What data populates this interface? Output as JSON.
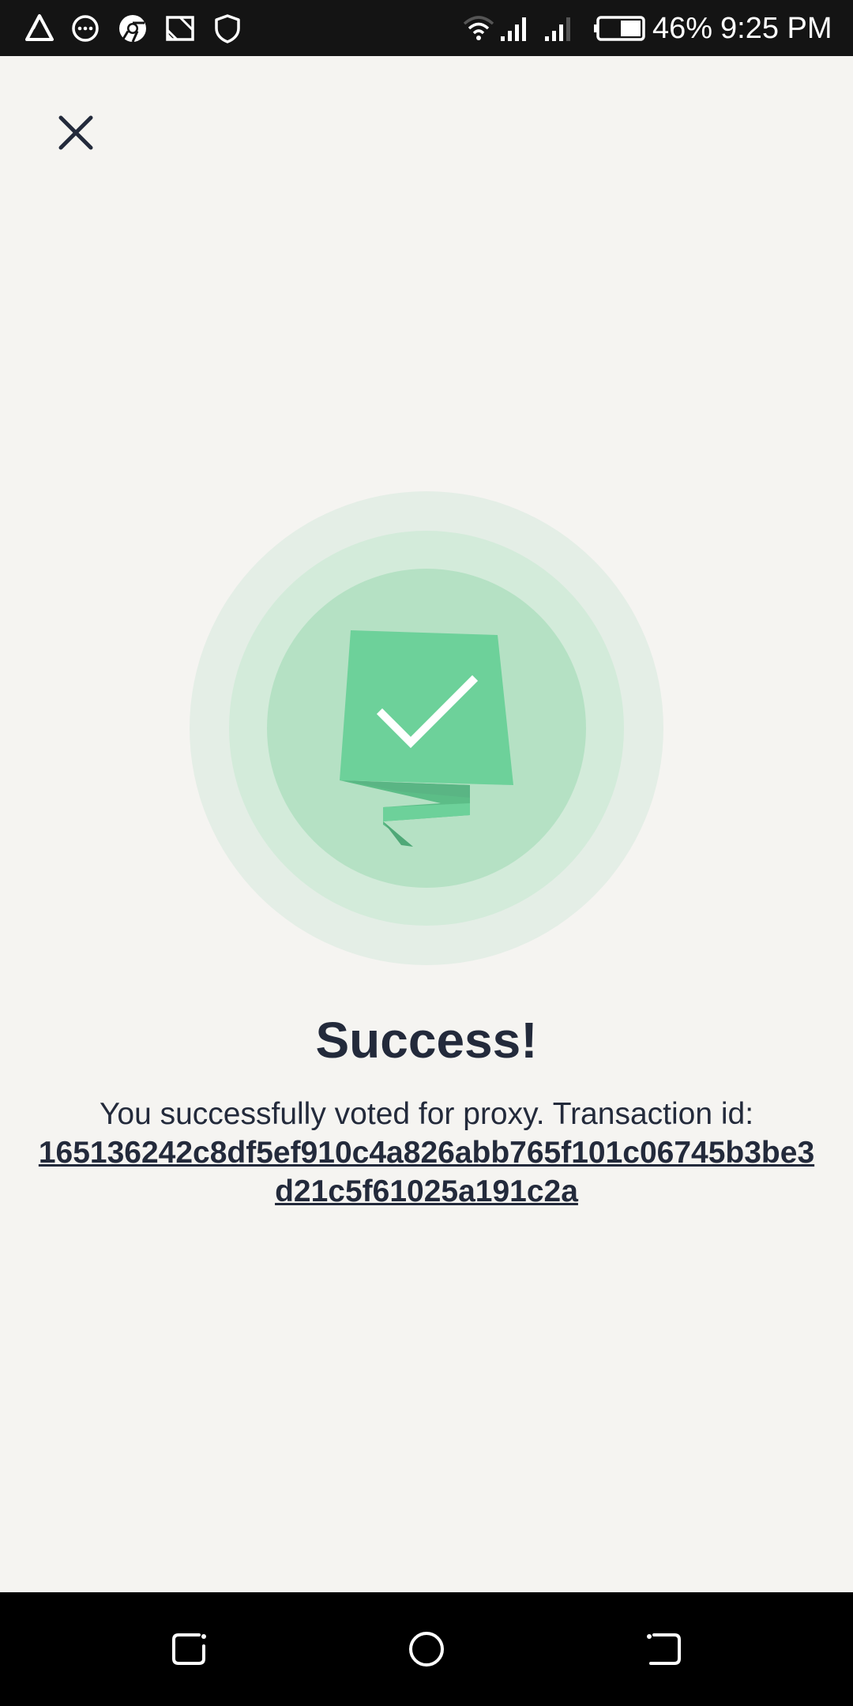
{
  "status_bar": {
    "battery_percent": "46%",
    "time": "9:25 PM",
    "icons": [
      "drive-icon",
      "messages-icon",
      "chrome-icon",
      "cast-icon",
      "shield-icon",
      "wifi-icon",
      "signal-icon",
      "signal-icon-2",
      "battery-icon"
    ]
  },
  "header": {
    "close_icon": "close-icon"
  },
  "success": {
    "illustration_icon": "check-banner-icon",
    "title": "Success!",
    "message": "You successfully voted for proxy. Transaction id:",
    "transaction_id": "165136242c8df5ef910c4a826abb765f101c06745b3be3d21c5f61025a191c2a"
  },
  "colors": {
    "background": "#f5f4f1",
    "text": "#232a3b",
    "accent_green": "#6dd19a",
    "circle_outer": "#e4eee6",
    "circle_mid": "#d3ebda",
    "circle_inner": "#b5e1c4"
  },
  "nav_bar": {
    "icons": [
      "recents-icon",
      "home-icon",
      "back-icon"
    ]
  }
}
